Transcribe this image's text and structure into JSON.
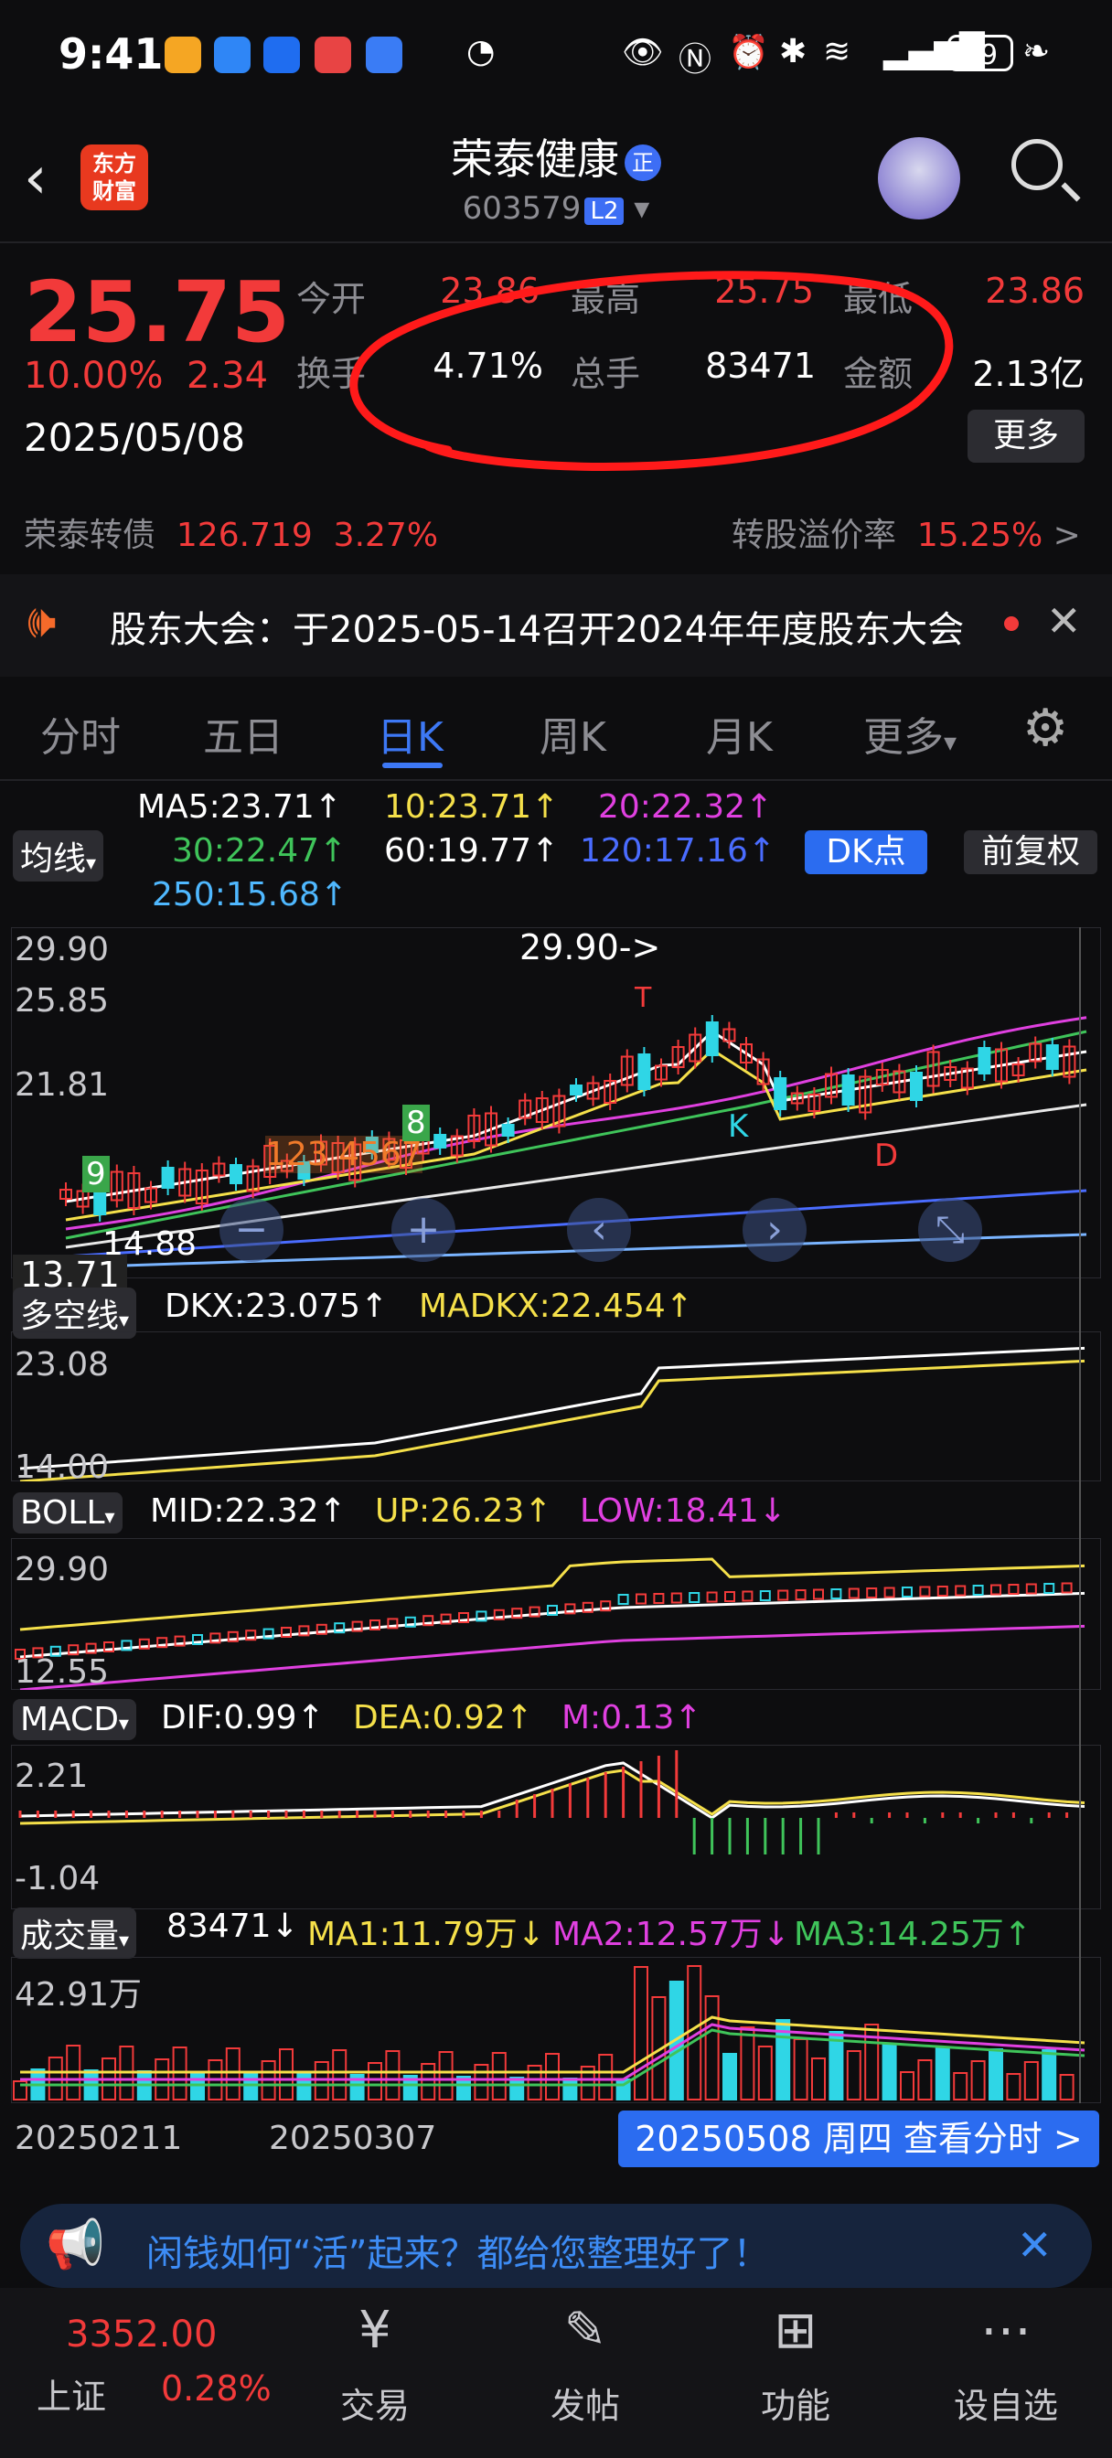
{
  "status_bar": {
    "time": "9:41",
    "battery": "89"
  },
  "header": {
    "name": "荣泰健康",
    "badge": "正",
    "code": "603579",
    "level": "L2",
    "logo_line1": "东方",
    "logo_line2": "财富"
  },
  "quote": {
    "price": "25.75",
    "change_pct": "10.00%",
    "change": "2.34",
    "date": "2025/05/08",
    "open_label": "今开",
    "open": "23.86",
    "high_label": "最高",
    "high": "25.75",
    "low_label": "最低",
    "low": "23.86",
    "turnover_label": "换手",
    "turnover": "4.71%",
    "volume_label": "总手",
    "volume": "83471",
    "amount_label": "金额",
    "amount": "2.13亿",
    "more": "更多"
  },
  "convertible": {
    "name": "荣泰转债",
    "price": "126.719",
    "pct": "3.27%",
    "premium_label": "转股溢价率",
    "premium": "15.25%",
    "arrow": ">"
  },
  "notice": {
    "text": "股东大会：于2025-05-14召开2024年年度股东大会"
  },
  "tabs": [
    "分时",
    "五日",
    "日K",
    "周K",
    "月K",
    "更多"
  ],
  "ma": {
    "selector": "均线",
    "ma5": "MA5:23.71↑",
    "ma10": "10:23.71↑",
    "ma20": "20:22.32↑",
    "ma30": "30:22.47↑",
    "ma60": "60:19.77↑",
    "ma120": "120:17.16↑",
    "ma250": "250:15.68↑",
    "dk": "DK点",
    "adjust": "前复权"
  },
  "kline": {
    "y_top": "29.90",
    "y_mid1": "25.85",
    "y_mid2": "21.81",
    "y_low": "13.71",
    "max_label": "29.90->",
    "min_label": "14.88",
    "nums": "123 4567",
    "n8": "8",
    "n9": "9",
    "letter_k": "K",
    "letter_d": "D",
    "letter_t": "T"
  },
  "dkx": {
    "selector": "多空线",
    "dkx": "DKX:23.075↑",
    "madkx": "MADKX:22.454↑",
    "y_top": "23.08",
    "y_bottom": "14.00"
  },
  "boll": {
    "selector": "BOLL",
    "mid": "MID:22.32↑",
    "up": "UP:26.23↑",
    "low": "LOW:18.41↓",
    "y_top": "29.90",
    "y_bottom": "12.55"
  },
  "macd": {
    "selector": "MACD",
    "dif": "DIF:0.99↑",
    "dea": "DEA:0.92↑",
    "m": "M:0.13↑",
    "y_top": "2.21",
    "y_bottom": "-1.04"
  },
  "vol": {
    "selector": "成交量",
    "value": "83471↓",
    "ma1": "MA1:11.79万↓",
    "ma2": "MA2:12.57万↓",
    "ma3": "MA3:14.25万↑",
    "y_top": "42.91万"
  },
  "dates": {
    "d1": "20250211",
    "d2": "20250307",
    "current": "20250508 周四 查看分时 >"
  },
  "ad": {
    "text": "闲钱如何“活”起来？都给您整理好了！"
  },
  "bottom_nav": {
    "index_value": "3352.00",
    "index_name": "上证",
    "index_pct": "0.28%",
    "items": [
      "交易",
      "发帖",
      "功能",
      "设自选"
    ]
  },
  "colors": {
    "up": "#f23a3a",
    "down": "#2fd6e6",
    "accent": "#3d78f5"
  }
}
